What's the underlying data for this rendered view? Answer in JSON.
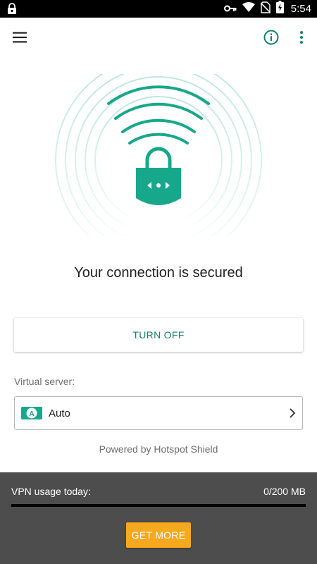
{
  "status_bar": {
    "time": "5:54",
    "icons": [
      "vpn-lock-icon",
      "key-icon",
      "wifi-icon",
      "no-sim-icon",
      "battery-charging-icon"
    ]
  },
  "app_bar": {
    "icons": [
      "menu-icon",
      "info-icon",
      "more-vert-icon"
    ]
  },
  "hero": {
    "icon": "lock-icon",
    "accent": "#17a88b"
  },
  "status_message": "Your connection is secured",
  "turn_off_button": "TURN OFF",
  "virtual_server": {
    "label": "Virtual server:",
    "flag_letter": "A",
    "value": "Auto"
  },
  "powered_by": "Powered by Hotspot Shield",
  "usage": {
    "label": "VPN usage today:",
    "amount_text": "0/200 MB",
    "used_fraction": 0
  },
  "get_more_button": "GET MORE",
  "colors": {
    "accent": "#17a88b",
    "turn_off_text": "#12836f",
    "panel": "#4d4d4d",
    "cta": "#f7a91d"
  }
}
